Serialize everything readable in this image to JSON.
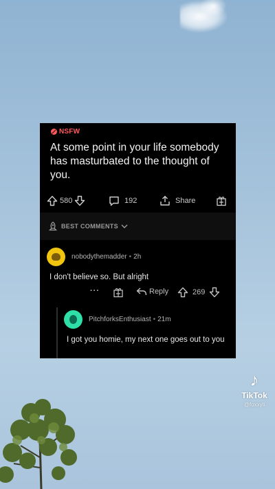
{
  "post": {
    "nsfw_label": "NSFW",
    "title": "At some point in your life somebody has masturbated to the thought of you.",
    "upvotes": "580",
    "comments": "192",
    "share_label": "Share"
  },
  "sort": {
    "label": "BEST COMMENTS"
  },
  "comments": [
    {
      "author": "nobodythemadder",
      "age": "2h",
      "body": "I don't believe so. But alright",
      "reply_label": "Reply",
      "votes": "269"
    },
    {
      "author": "PitchforksEnthusiast",
      "age": "21m",
      "body": "I got you homie, my next one goes out to you"
    }
  ],
  "watermark": {
    "brand": "TikTok",
    "handle": "@foxxyli"
  },
  "colors": {
    "nsfw": "#ff585b",
    "card_bg": "#000000",
    "avatar_1": "#f1c40f",
    "avatar_2": "#2ee0a8"
  }
}
